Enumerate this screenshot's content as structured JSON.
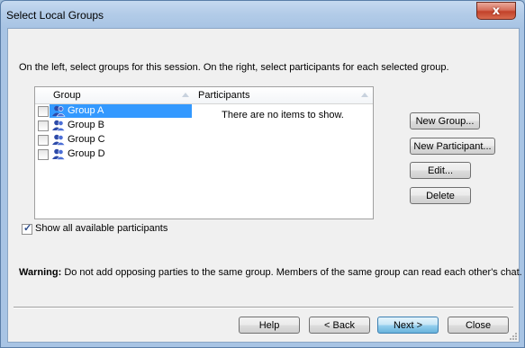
{
  "window": {
    "title": "Select Local Groups",
    "close_label": "x"
  },
  "instructions": "On the left, select groups for this session. On the right, select participants for each selected group.",
  "groups_panel": {
    "header": "Group",
    "items": [
      {
        "label": "Group A",
        "selected": true,
        "checked": false
      },
      {
        "label": "Group B",
        "selected": false,
        "checked": false
      },
      {
        "label": "Group C",
        "selected": false,
        "checked": false
      },
      {
        "label": "Group D",
        "selected": false,
        "checked": false
      }
    ]
  },
  "participants_panel": {
    "header": "Participants",
    "empty_text": "There are no items to show."
  },
  "side_buttons": {
    "new_group": "New Group...",
    "new_participant": "New Participant...",
    "edit": "Edit...",
    "delete": "Delete"
  },
  "show_all": {
    "label": "Show all available participants",
    "checked": true
  },
  "warning": {
    "prefix": "Warning:",
    "text": "Do not add opposing parties to the same group. Members of the same group can read each other's chat."
  },
  "footer_buttons": {
    "help": "Help",
    "back": "< Back",
    "next": "Next >",
    "close": "Close"
  },
  "colors": {
    "selection": "#3399ff",
    "title_bar": "#b3cce8",
    "close_button": "#c2422a"
  }
}
